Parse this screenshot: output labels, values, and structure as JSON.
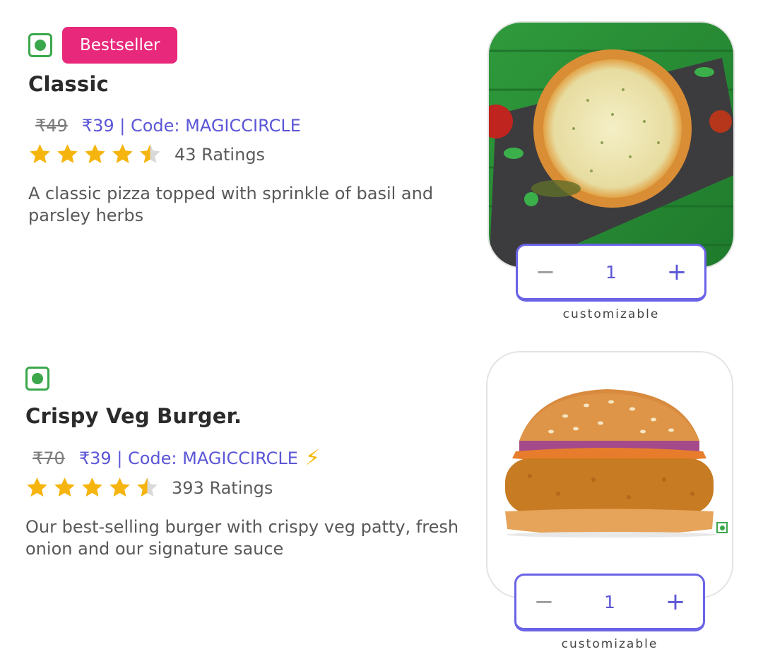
{
  "items": [
    {
      "badge": "Bestseller",
      "name": "Classic",
      "original_price": "₹49",
      "offer_text": "₹39 | Code: MAGICCIRCLE",
      "rating": 4.5,
      "ratings_text": "43 Ratings",
      "description": "A classic pizza topped with sprinkle of basil and parsley herbs",
      "quantity": "1",
      "customizable_label": "customizable",
      "image_icon": "pizza-photo"
    },
    {
      "name": "Crispy Veg Burger.",
      "original_price": "₹70",
      "offer_text": "₹39 | Code: MAGICCIRCLE",
      "offer_icon": "lightning-icon",
      "rating": 4.5,
      "ratings_text": "393 Ratings",
      "description": "Our best-selling burger with crispy veg patty, fresh onion and our signature sauce",
      "quantity": "1",
      "customizable_label": "customizable",
      "image_icon": "burger-photo"
    }
  ],
  "colors": {
    "accent": "#5b56d6",
    "bestseller": "#e8287a",
    "veg": "#3aa74b",
    "star": "#f6b40e"
  },
  "icons": {
    "minus": "−",
    "plus": "+",
    "bolt": "⚡"
  }
}
